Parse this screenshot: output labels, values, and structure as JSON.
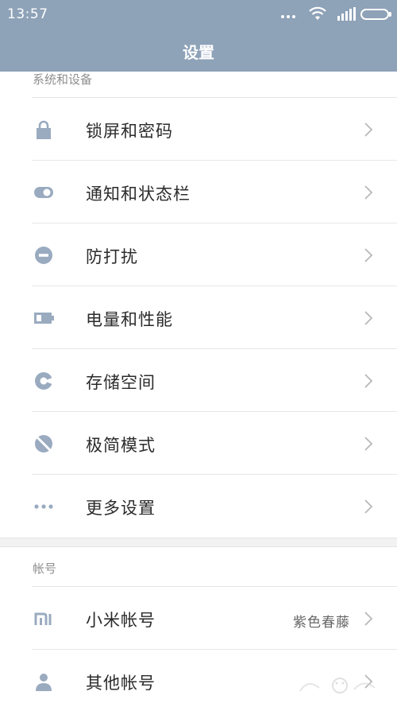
{
  "status_bar": {
    "time": "13:57"
  },
  "header": {
    "title": "设置"
  },
  "section_system": {
    "label": "系统和设备",
    "items": [
      {
        "label": "锁屏和密码",
        "icon": "lock-icon"
      },
      {
        "label": "通知和状态栏",
        "icon": "toggle-icon"
      },
      {
        "label": "防打扰",
        "icon": "do-not-disturb-icon"
      },
      {
        "label": "电量和性能",
        "icon": "battery-icon"
      },
      {
        "label": "存储空间",
        "icon": "storage-pie-icon"
      },
      {
        "label": "极简模式",
        "icon": "minimal-mode-icon"
      },
      {
        "label": "更多设置",
        "icon": "more-dots-icon"
      }
    ]
  },
  "section_account": {
    "label": "帐号",
    "items": [
      {
        "label": "小米帐号",
        "value": "紫色春藤",
        "icon": "mi-logo-icon"
      },
      {
        "label": "其他帐号",
        "icon": "person-icon"
      }
    ]
  },
  "colors": {
    "header_bg": "#8ea2b8",
    "icon": "#9aabc0",
    "text": "#2b2b2b",
    "section_label": "#8f8f8f"
  }
}
